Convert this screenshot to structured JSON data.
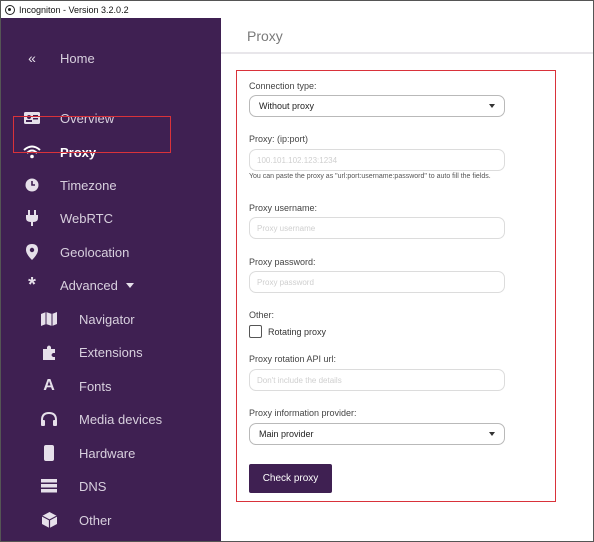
{
  "window": {
    "title": "Incogniton - Version 3.2.0.2"
  },
  "sidebar": {
    "items": [
      {
        "label": "Home",
        "icon": "double-chevron-left-icon"
      },
      {
        "label": "Overview",
        "icon": "id-card-icon"
      },
      {
        "label": "Proxy",
        "icon": "wifi-icon"
      },
      {
        "label": "Timezone",
        "icon": "clock-icon"
      },
      {
        "label": "WebRTC",
        "icon": "plug-icon"
      },
      {
        "label": "Geolocation",
        "icon": "map-pin-icon"
      },
      {
        "label": "Advanced",
        "icon": "asterisk-icon"
      },
      {
        "label": "Navigator",
        "icon": "map-icon"
      },
      {
        "label": "Extensions",
        "icon": "puzzle-icon"
      },
      {
        "label": "Fonts",
        "icon": "font-icon"
      },
      {
        "label": "Media devices",
        "icon": "headphones-icon"
      },
      {
        "label": "Hardware",
        "icon": "phone-icon"
      },
      {
        "label": "DNS",
        "icon": "server-icon"
      },
      {
        "label": "Other",
        "icon": "cube-icon"
      }
    ]
  },
  "header": {
    "title": "Proxy"
  },
  "form": {
    "connection_type": {
      "label": "Connection type:",
      "value": "Without proxy"
    },
    "proxy": {
      "label": "Proxy: (ip:port)",
      "placeholder": "100.101.102.123:1234",
      "help": "You can paste the proxy as \"url:port:username:password\" to auto fill the fields."
    },
    "username": {
      "label": "Proxy username:",
      "placeholder": "Proxy username"
    },
    "password": {
      "label": "Proxy password:",
      "placeholder": "Proxy password"
    },
    "other": {
      "label": "Other:",
      "rotating_label": "Rotating proxy",
      "rotating_checked": false
    },
    "rotation_url": {
      "label": "Proxy rotation API url:",
      "placeholder": "Don't include the details"
    },
    "info_provider": {
      "label": "Proxy information provider:",
      "value": "Main provider"
    },
    "check_button": "Check proxy"
  },
  "colors": {
    "sidebar_bg": "#3f2052",
    "accent_red": "#d9323a",
    "button_bg": "#3f2052"
  }
}
